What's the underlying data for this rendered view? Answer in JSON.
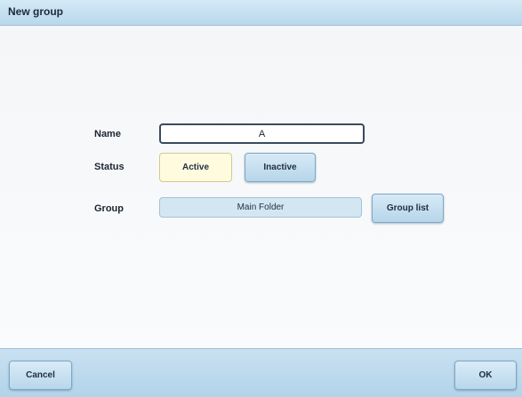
{
  "window": {
    "title": "New group"
  },
  "form": {
    "name_label": "Name",
    "name_value": "A",
    "status_label": "Status",
    "status_options": [
      "Active",
      "Inactive"
    ],
    "status_selected": "Active",
    "group_label": "Group",
    "group_value": "Main Folder",
    "group_list_button": "Group list"
  },
  "footer": {
    "cancel_label": "Cancel",
    "ok_label": "OK"
  },
  "colors": {
    "title_bar": "#c6e1f2",
    "selected_button": "#fffbdf",
    "button": "#c4def0",
    "footer": "#bedaed"
  }
}
